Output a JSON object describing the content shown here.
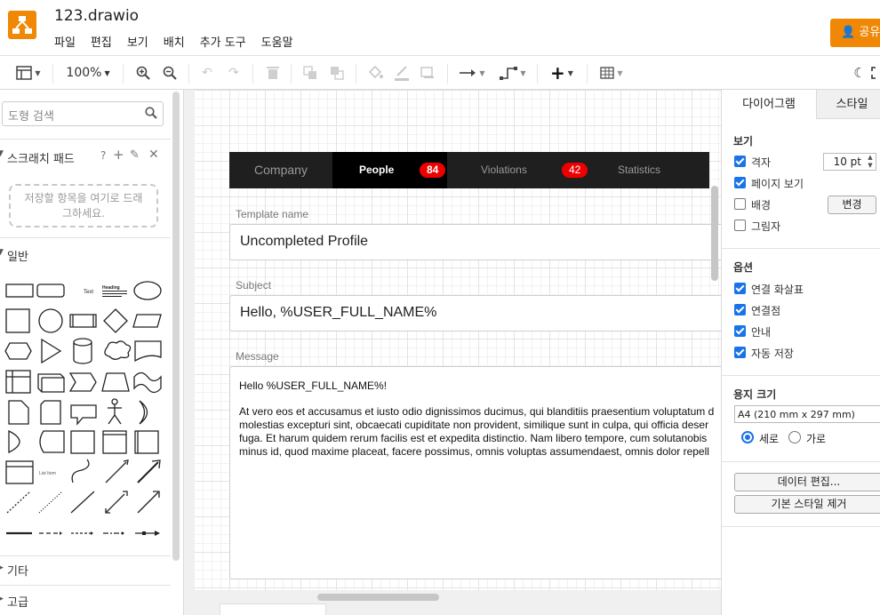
{
  "app": {
    "file_name": "123.drawio",
    "menu": [
      "파일",
      "편집",
      "보기",
      "배치",
      "추가 도구",
      "도움말"
    ],
    "share_label": "공유",
    "zoom": "100%"
  },
  "left_panel": {
    "search_placeholder": "도형 검색",
    "scratchpad_title": "스크래치 패드",
    "scratchpad_help": "?",
    "scratchpad_hint_line1": "저장할 항목을 여기로 드래",
    "scratchpad_hint_line2": "그하세요.",
    "section_general": "일반",
    "section_other": "기타",
    "section_advanced": "고급",
    "shape_text": "Text",
    "shape_heading": "Heading",
    "shape_list": "List Item"
  },
  "diagram": {
    "tabs": [
      {
        "label": "Company",
        "badge": ""
      },
      {
        "label": "People",
        "badge": "84"
      },
      {
        "label": "Violations",
        "badge": "42"
      },
      {
        "label": "Statistics",
        "badge": ""
      }
    ],
    "template_label": "Template name",
    "template_value": "Uncompleted Profile",
    "subject_label": "Subject",
    "subject_value": "Hello, %USER_FULL_NAME%",
    "message_label": "Message",
    "message_greeting": "Hello %USER_FULL_NAME%!",
    "message_body": [
      "At vero eos et accusamus et iusto odio dignissimos ducimus, qui blanditiis praesentium voluptatum d",
      "molestias excepturi sint, obcaecati cupiditate non provident, similique sunt in culpa, qui officia deser",
      "fuga. Et harum quidem rerum facilis est et expedita distinctio. Nam libero tempore, cum solutanobis",
      "minus id, quod maxime placeat, facere possimus, omnis voluptas assumendaest, omnis dolor repell"
    ]
  },
  "right_panel": {
    "tab_diagram": "다이어그램",
    "tab_style": "스타일",
    "view_heading": "보기",
    "grid_label": "격자",
    "grid_size": "10 pt",
    "page_view_label": "페이지 보기",
    "background_label": "배경",
    "change_button": "변경",
    "shadow_label": "그림자",
    "options_heading": "옵션",
    "connection_arrows": "연결 화살표",
    "connection_points": "연결점",
    "guides": "안내",
    "autosave": "자동 저장",
    "paper_heading": "용지 크기",
    "paper_size": "A4 (210 mm x 297 mm)",
    "portrait": "세로",
    "landscape": "가로",
    "edit_data_button": "데이터 편집...",
    "clear_style_button": "기본 스타일 제거"
  },
  "colors": {
    "brand": "#f08705",
    "tabbar": "#1f1f1f",
    "active_tab": "#000000",
    "badge": "#e00000",
    "checkbox": "#1a73e8"
  }
}
